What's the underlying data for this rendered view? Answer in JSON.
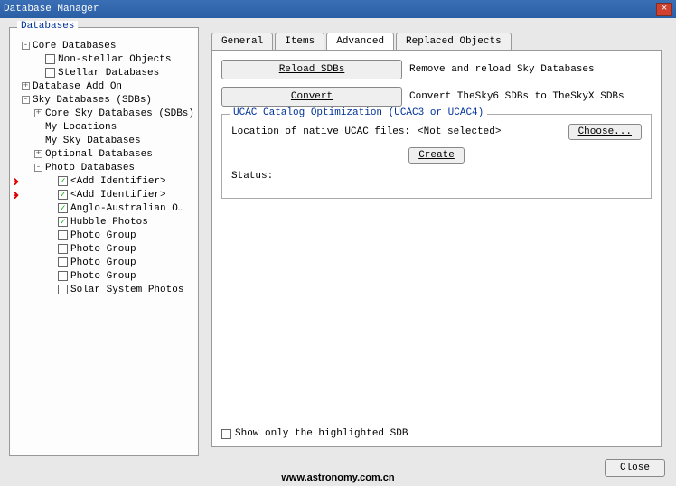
{
  "window_title": "Database Manager",
  "left": {
    "title": "Databases",
    "tree": [
      {
        "ind": 0,
        "exp": "-",
        "chk": null,
        "label": "Core Databases"
      },
      {
        "ind": 1,
        "exp": null,
        "chk": false,
        "label": "Non-stellar Objects"
      },
      {
        "ind": 1,
        "exp": null,
        "chk": false,
        "label": "Stellar Databases"
      },
      {
        "ind": 0,
        "exp": "+",
        "chk": null,
        "label": "Database Add On"
      },
      {
        "ind": 0,
        "exp": "-",
        "chk": null,
        "label": "Sky Databases (SDBs)"
      },
      {
        "ind": 1,
        "exp": "+",
        "chk": null,
        "label": "Core Sky Databases (SDBs)"
      },
      {
        "ind": 1,
        "exp": null,
        "chk": null,
        "label": "My Locations"
      },
      {
        "ind": 1,
        "exp": null,
        "chk": null,
        "label": "My Sky Databases"
      },
      {
        "ind": 1,
        "exp": "+",
        "chk": null,
        "label": "Optional Databases"
      },
      {
        "ind": 1,
        "exp": "-",
        "chk": null,
        "label": "Photo Databases"
      },
      {
        "ind": 2,
        "exp": null,
        "chk": true,
        "label": "<Add Identifier>",
        "arrow": true
      },
      {
        "ind": 2,
        "exp": null,
        "chk": true,
        "label": "<Add Identifier>",
        "arrow": true
      },
      {
        "ind": 2,
        "exp": null,
        "chk": true,
        "label": "Anglo-Australian O…"
      },
      {
        "ind": 2,
        "exp": null,
        "chk": true,
        "label": "Hubble Photos"
      },
      {
        "ind": 2,
        "exp": null,
        "chk": false,
        "label": "Photo Group"
      },
      {
        "ind": 2,
        "exp": null,
        "chk": false,
        "label": "Photo Group"
      },
      {
        "ind": 2,
        "exp": null,
        "chk": false,
        "label": "Photo Group"
      },
      {
        "ind": 2,
        "exp": null,
        "chk": false,
        "label": "Photo Group"
      },
      {
        "ind": 2,
        "exp": null,
        "chk": false,
        "label": "Solar System Photos"
      }
    ]
  },
  "tabs": [
    "General",
    "Items",
    "Advanced",
    "Replaced Objects"
  ],
  "active_tab": 2,
  "reload_btn": "Reload SDBs",
  "reload_desc": "Remove and reload Sky Databases",
  "convert_btn": "Convert",
  "convert_desc": "Convert TheSky6 SDBs to TheSkyX SDBs",
  "ucac_title": "UCAC Catalog Optimization (UCAC3 or UCAC4)",
  "ucac_loc_label": "Location of native UCAC files:",
  "ucac_loc_value": "<Not selected>",
  "choose_btn": "Choose...",
  "create_btn": "Create",
  "status_label": "Status:",
  "show_only": "Show only the highlighted SDB",
  "close_btn": "Close",
  "watermark": "www.astronomy.com.cn"
}
